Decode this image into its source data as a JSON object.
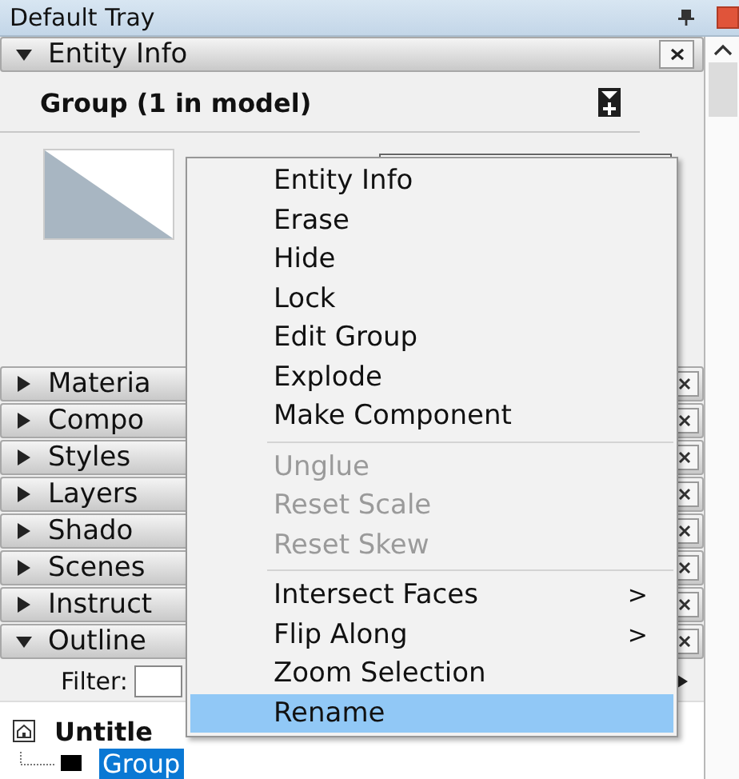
{
  "tray": {
    "title": "Default Tray"
  },
  "entity_info": {
    "title": "Entity Info",
    "expanded": true,
    "heading": "Group (1 in model)"
  },
  "panels": [
    {
      "label": "Materia",
      "expanded": false
    },
    {
      "label": "Compo",
      "expanded": false
    },
    {
      "label": "Styles",
      "expanded": false
    },
    {
      "label": "Layers",
      "expanded": false
    },
    {
      "label": "Shado",
      "expanded": false
    },
    {
      "label": "Scenes",
      "expanded": false
    },
    {
      "label": "Instruct",
      "expanded": false
    },
    {
      "label": "Outline",
      "expanded": true
    }
  ],
  "outliner": {
    "filter_label": "Filter:",
    "tree": [
      {
        "label": "Untitle",
        "kind": "model",
        "selected": false,
        "children": [
          {
            "label": "Group",
            "kind": "group",
            "selected": true
          }
        ]
      }
    ]
  },
  "context_menu": {
    "items": [
      {
        "kind": "item",
        "label": "Entity Info",
        "disabled": false,
        "selected": false
      },
      {
        "kind": "item",
        "label": "Erase",
        "disabled": false,
        "selected": false
      },
      {
        "kind": "item",
        "label": "Hide",
        "disabled": false,
        "selected": false
      },
      {
        "kind": "item",
        "label": "Lock",
        "disabled": false,
        "selected": false
      },
      {
        "kind": "item",
        "label": "Edit Group",
        "disabled": false,
        "selected": false
      },
      {
        "kind": "item",
        "label": "Explode",
        "disabled": false,
        "selected": false
      },
      {
        "kind": "item",
        "label": "Make Component",
        "disabled": false,
        "selected": false
      },
      {
        "kind": "separator"
      },
      {
        "kind": "item",
        "label": "Unglue",
        "disabled": true,
        "selected": false
      },
      {
        "kind": "item",
        "label": "Reset Scale",
        "disabled": true,
        "selected": false
      },
      {
        "kind": "item",
        "label": "Reset Skew",
        "disabled": true,
        "selected": false
      },
      {
        "kind": "separator"
      },
      {
        "kind": "item",
        "label": "Intersect Faces",
        "disabled": false,
        "selected": false,
        "arrow": ">"
      },
      {
        "kind": "item",
        "label": "Flip Along",
        "disabled": false,
        "selected": false,
        "arrow": ">"
      },
      {
        "kind": "item",
        "label": "Zoom Selection",
        "disabled": false,
        "selected": false
      },
      {
        "kind": "item",
        "label": "Rename",
        "disabled": false,
        "selected": true
      }
    ]
  }
}
